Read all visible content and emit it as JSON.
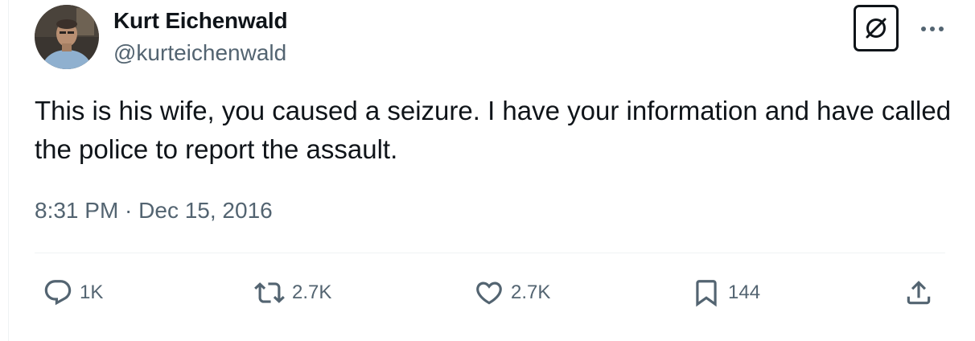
{
  "author": {
    "name": "Kurt Eichenwald",
    "handle": "@kurteichenwald",
    "avatar_icon": "profile-photo"
  },
  "header_buttons": {
    "grok_icon": "grok-icon",
    "more_icon": "more-icon"
  },
  "tweet": {
    "text": "This is his wife, you caused a seizure. I have your information and have called the police to report the assault.",
    "timestamp": "8:31 PM · Dec 15, 2016"
  },
  "actions": {
    "reply": {
      "icon": "reply-icon",
      "count": "1K"
    },
    "retweet": {
      "icon": "retweet-icon",
      "count": "2.7K"
    },
    "like": {
      "icon": "like-icon",
      "count": "2.7K"
    },
    "bookmark": {
      "icon": "bookmark-icon",
      "count": "144"
    },
    "share": {
      "icon": "share-icon"
    }
  },
  "colors": {
    "text_primary": "#0f1419",
    "text_secondary": "#536471",
    "divider": "#eff3f4"
  }
}
